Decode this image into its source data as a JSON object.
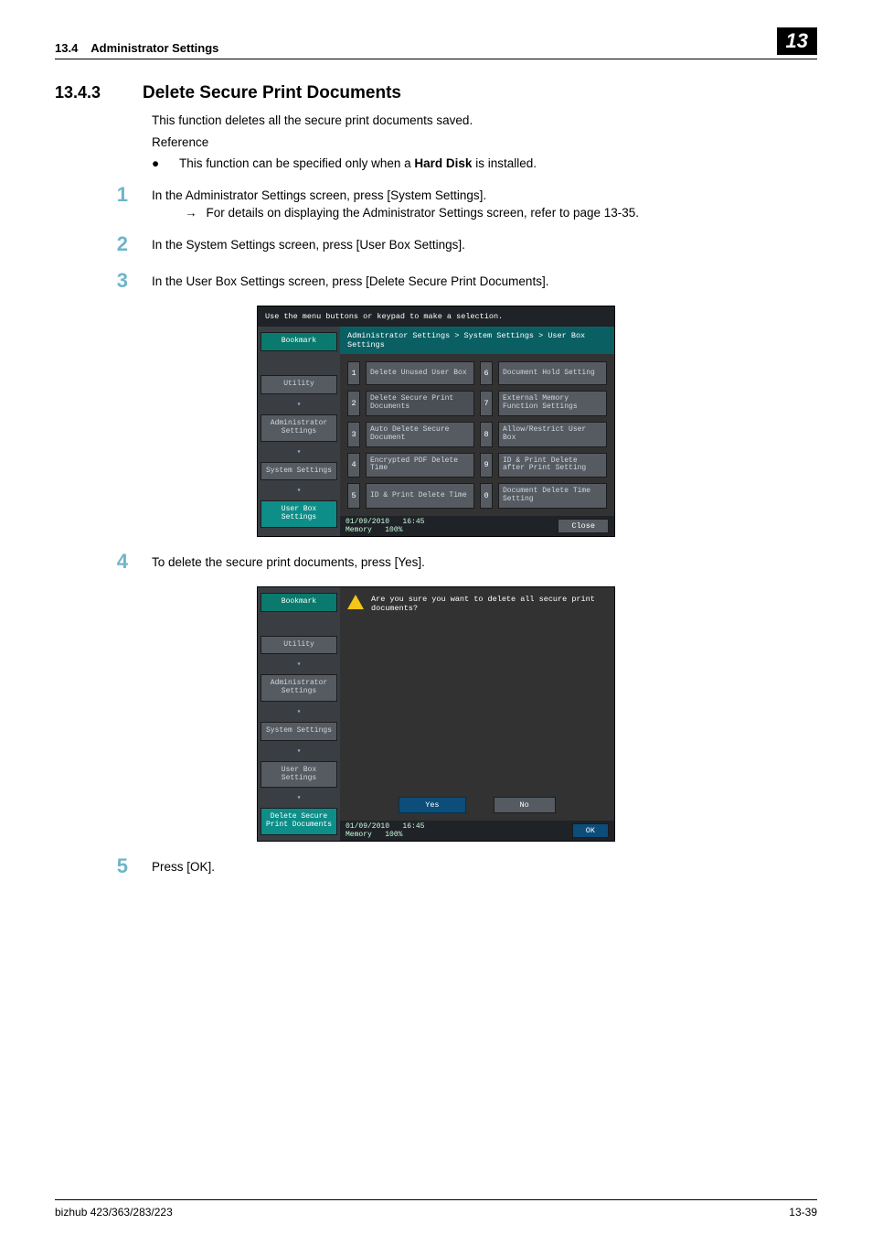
{
  "header": {
    "section_ref": "13.4",
    "section_title": "Administrator Settings",
    "chapter": "13"
  },
  "section": {
    "number": "13.4.3",
    "title": "Delete Secure Print Documents"
  },
  "intro": {
    "desc": "This function deletes all the secure print documents saved.",
    "reference_label": "Reference",
    "bullet_pre": "This function can be specified only when a ",
    "bullet_bold": "Hard Disk",
    "bullet_post": " is installed."
  },
  "steps": {
    "s1": "In the Administrator Settings screen, press [System Settings].",
    "s1_sub": "For details on displaying the Administrator Settings screen, refer to page 13-35.",
    "s2": "In the System Settings screen, press [User Box Settings].",
    "s3": "In the User Box Settings screen, press [Delete Secure Print Documents].",
    "s4": "To delete the secure print documents, press [Yes].",
    "s5": "Press [OK]."
  },
  "screen1": {
    "topbar": "Use the menu buttons or keypad to make a selection.",
    "crumb": "Administrator Settings > System Settings > User Box Settings",
    "side": {
      "bookmark": "Bookmark",
      "utility": "Utility",
      "admin": "Administrator Settings",
      "system": "System Settings",
      "userbox": "User Box Settings"
    },
    "menu": {
      "n1": "1",
      "m1": "Delete Unused User Box",
      "n6": "6",
      "m6": "Document Hold Setting",
      "n2": "2",
      "m2": "Delete Secure Print Documents",
      "n7": "7",
      "m7": "External Memory Function Settings",
      "n3": "3",
      "m3": "Auto Delete Secure Document",
      "n8": "8",
      "m8": "Allow/Restrict User Box",
      "n4": "4",
      "m4": "Encrypted PDF Delete Time",
      "n9": "9",
      "m9": "ID & Print Delete after Print Setting",
      "n5": "5",
      "m5": "ID & Print Delete Time",
      "n0": "0",
      "m0": "Document Delete Time Setting"
    },
    "status": {
      "date": "01/09/2010",
      "time": "16:45",
      "mem_label": "Memory",
      "mem_val": "100%",
      "close": "Close"
    }
  },
  "screen2": {
    "msg": "Are you sure you want to delete all secure print documents?",
    "side": {
      "bookmark": "Bookmark",
      "utility": "Utility",
      "admin": "Administrator Settings",
      "system": "System Settings",
      "userbox": "User Box Settings",
      "delsecure": "Delete Secure Print Documents"
    },
    "yes": "Yes",
    "no": "No",
    "status": {
      "date": "01/09/2010",
      "time": "16:45",
      "mem_label": "Memory",
      "mem_val": "100%",
      "ok": "OK"
    }
  },
  "footer": {
    "left": "bizhub 423/363/283/223",
    "right": "13-39"
  },
  "nums": {
    "n1": "1",
    "n2": "2",
    "n3": "3",
    "n4": "4",
    "n5": "5"
  },
  "glyph": {
    "bullet": "●",
    "arrow": "→",
    "down": "▾"
  }
}
